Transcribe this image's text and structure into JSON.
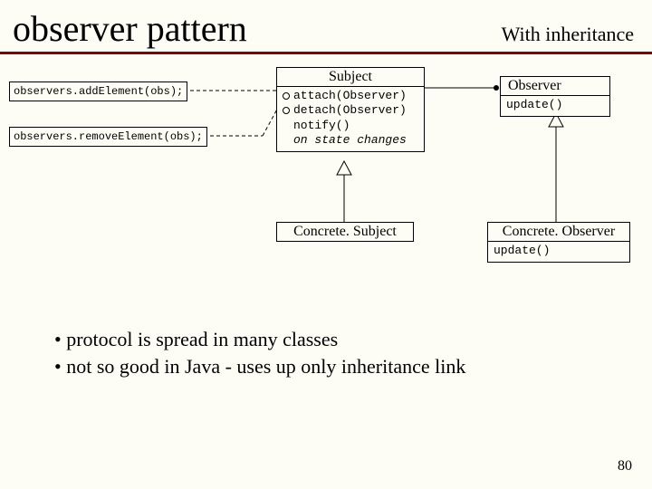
{
  "title": "observer pattern",
  "subtitle": "With inheritance",
  "notes": {
    "add": "observers.addElement(obs);",
    "remove": "observers.removeElement(obs);"
  },
  "classes": {
    "subject": {
      "name": "Subject",
      "lines": {
        "attach": "attach(Observer)",
        "detach": "detach(Observer)",
        "notify": "notify()",
        "onstate": "on state changes"
      }
    },
    "observer": {
      "name": "Observer",
      "lines": {
        "update": "update()"
      }
    },
    "concreteSubject": {
      "name": "Concrete. Subject"
    },
    "concreteObserver": {
      "name": "Concrete. Observer",
      "lines": {
        "update": "update()"
      }
    }
  },
  "bullets": {
    "b1": "protocol is spread in many classes",
    "b2": "not so good in Java - uses up only inheritance link"
  },
  "pageNumber": "80"
}
